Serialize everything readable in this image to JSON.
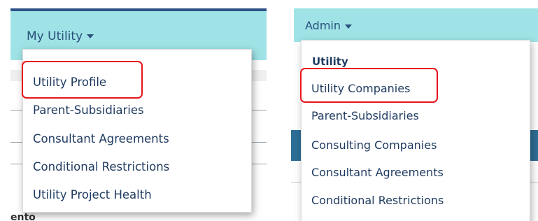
{
  "left_panel": {
    "nav_toggle_label": "My Utility",
    "menu_items": [
      "Utility Profile",
      "Parent-Subsidiaries",
      "Consultant Agreements",
      "Conditional Restrictions",
      "Utility Project Health"
    ],
    "highlighted_item": "Utility Profile",
    "partial_heading": "ento"
  },
  "right_panel": {
    "nav_toggle_label": "Admin",
    "menu_section_header": "Utility",
    "menu_items": [
      "Utility Companies",
      "Parent-Subsidiaries",
      "Consulting Companies",
      "Consultant Agreements",
      "Conditional Restrictions"
    ],
    "highlighted_item": "Utility Companies"
  },
  "colors": {
    "navbar_bg": "#9fe3e6",
    "menu_text": "#1e3a5f",
    "highlight_border": "#e8141b",
    "accent_band": "#2d5286"
  }
}
